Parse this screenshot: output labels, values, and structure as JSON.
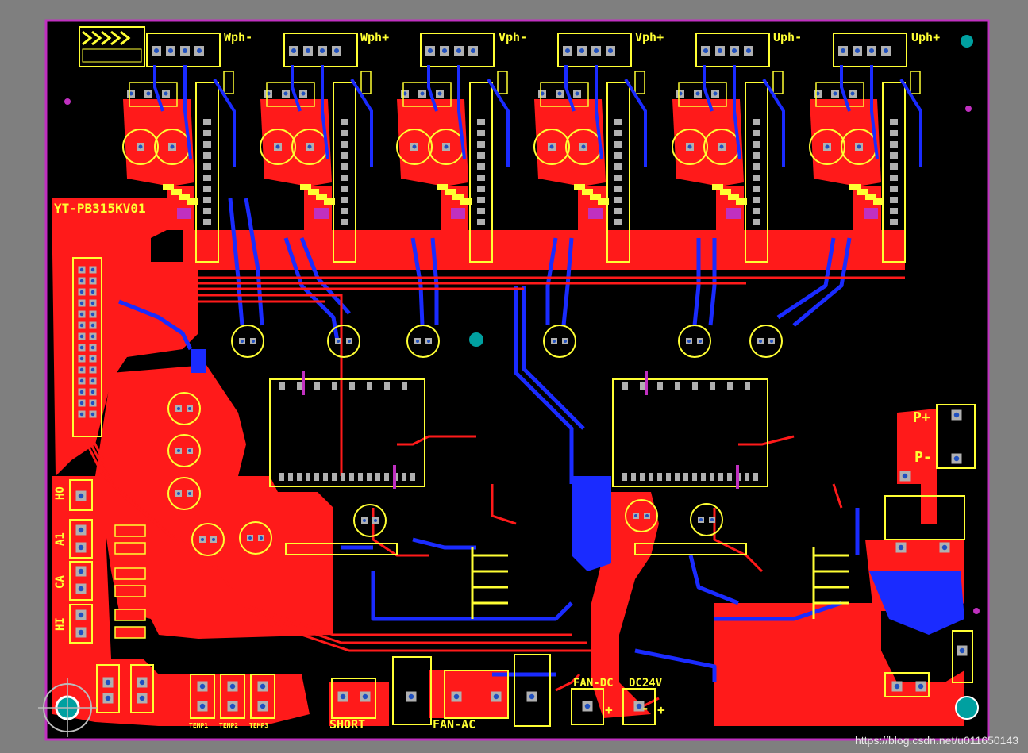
{
  "board": {
    "part_number": "YT-PB315KV01",
    "colors": {
      "background": "#000000",
      "frame": "#7f7f7f",
      "outline": "#c030c0",
      "top_copper": "#ff1a1a",
      "bottom_copper": "#1a2bff",
      "silkscreen": "#ffff33",
      "pad": "#b0b0b0",
      "via": "#00a0a0"
    },
    "phase_labels": [
      "Wph-",
      "Wph+",
      "Vph-",
      "Vph+",
      "Uph-",
      "Uph+"
    ],
    "connector_labels": [
      "HO",
      "A1",
      "CA",
      "HI"
    ],
    "power_labels": [
      "P+",
      "P-"
    ],
    "bottom_labels": {
      "short": "SHORT",
      "fan_ac": "FAN-AC",
      "fan_dc": "FAN-DC",
      "dc24v": "DC24V",
      "temp": [
        "TEMP1",
        "TEMP2",
        "TEMP3"
      ]
    },
    "polarity": [
      "+",
      "-",
      "+"
    ]
  },
  "watermark": "https://blog.csdn.net/u011650143"
}
